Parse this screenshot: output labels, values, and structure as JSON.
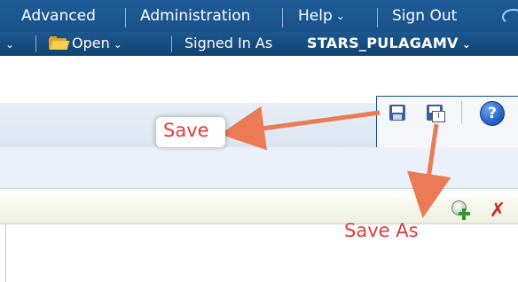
{
  "nav": {
    "advanced_label": "Advanced",
    "administration_label": "Administration",
    "help_label": "Help",
    "signout_label": "Sign Out"
  },
  "subnav": {
    "open_label": "Open",
    "signed_in_label": "Signed In As",
    "username": "STARS_PULAGAMV"
  },
  "icons": {
    "save": "floppy-disk-save-icon",
    "save_as": "floppy-disk-save-as-icon",
    "help": "help-question-icon",
    "help_glyph": "?",
    "add": "add-magnifier-icon",
    "remove": "remove-cross-icon",
    "remove_glyph": "✗",
    "caret_glyph": "⌄",
    "save_as_glyph": "I"
  },
  "annotations": {
    "save": "Save",
    "save_as": "Save As"
  },
  "colors": {
    "nav_blue": "#1f5c98",
    "annotation_red": "#e33b3b",
    "arrow_orange": "#ea7b54"
  }
}
